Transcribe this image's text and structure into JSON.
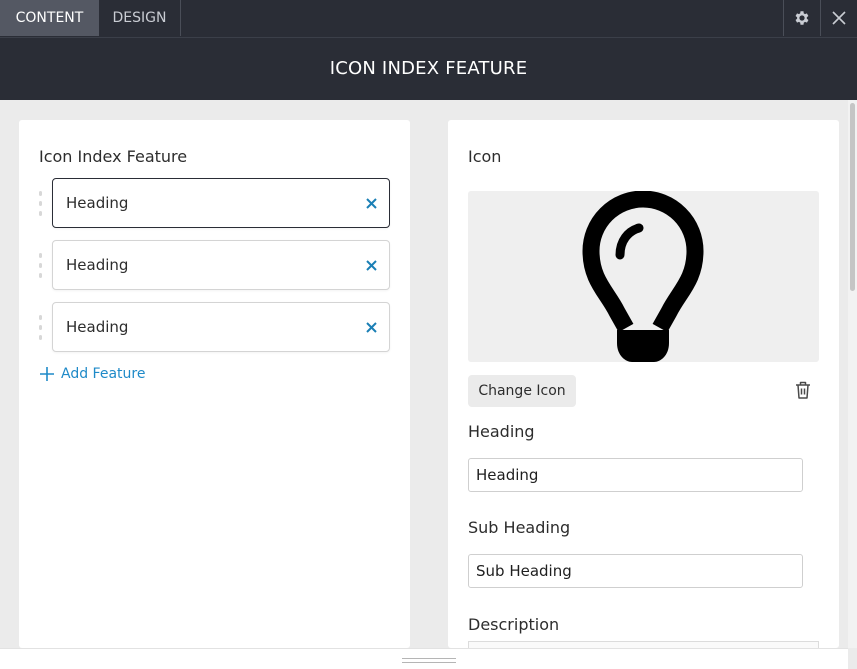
{
  "tabs": [
    {
      "label": "CONTENT",
      "active": true
    },
    {
      "label": "DESIGN",
      "active": false
    }
  ],
  "toolbar": {
    "settings_icon": "gear-icon",
    "close_icon": "close-icon"
  },
  "header": {
    "title": "ICON INDEX FEATURE"
  },
  "left_panel": {
    "title": "Icon Index Feature",
    "features": [
      {
        "label": "Heading",
        "active": true
      },
      {
        "label": "Heading",
        "active": false
      },
      {
        "label": "Heading",
        "active": false
      }
    ],
    "add_label": "Add Feature"
  },
  "right_panel": {
    "icon_label": "Icon",
    "preview_icon": "lightbulb-icon",
    "change_icon_label": "Change Icon",
    "delete_icon": "trash-icon",
    "heading_label": "Heading",
    "heading_value": "Heading",
    "subheading_label": "Sub Heading",
    "subheading_value": "Sub Heading",
    "description_label": "Description"
  },
  "colors": {
    "topbar": "#2a2d36",
    "accent": "#1f8ac8",
    "remove_x": "#1b7fb5",
    "panel_bg": "#ffffff",
    "page_bg": "#ebebeb"
  }
}
